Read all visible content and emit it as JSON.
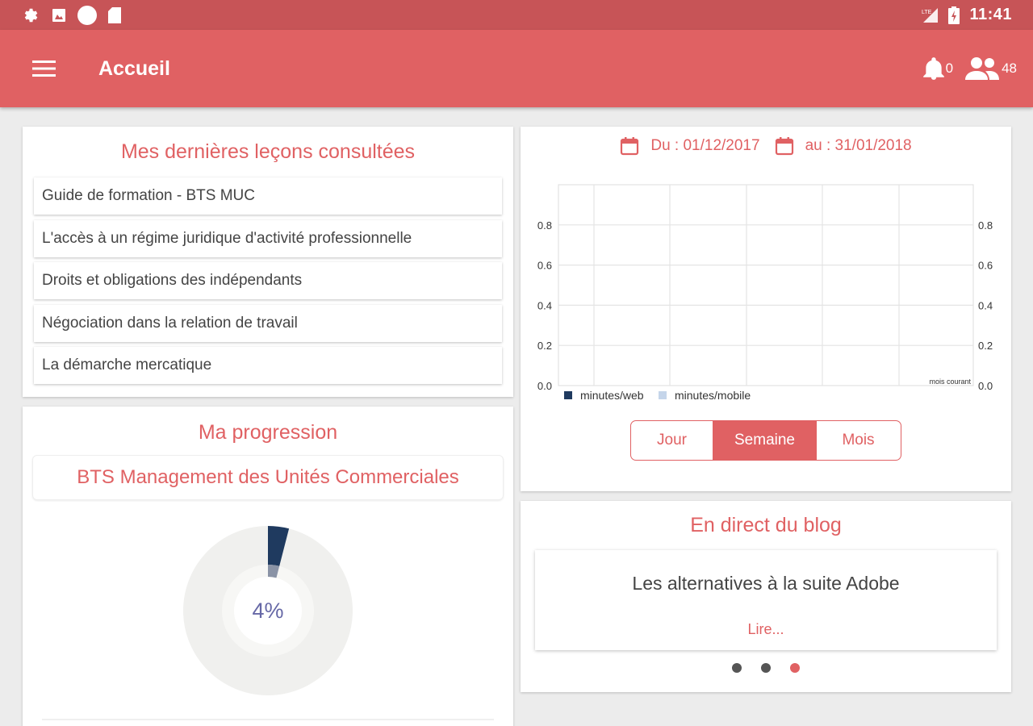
{
  "status_bar": {
    "time": "11:41",
    "icons": [
      "gear-icon",
      "image-icon",
      "circle-icon",
      "sd-card-icon",
      "signal-icon",
      "battery-charging-icon"
    ]
  },
  "app_bar": {
    "title": "Accueil",
    "notifications_count": "0",
    "users_count": "48"
  },
  "lessons": {
    "title": "Mes dernières leçons consultées",
    "items": [
      "Guide de formation - BTS MUC",
      "L'accès à un régime juridique d'activité professionnelle",
      "Droits et obligations des indépendants",
      "Négociation dans la relation de travail",
      "La démarche mercatique"
    ]
  },
  "progress": {
    "title": "Ma progression",
    "course": "BTS Management des Unités Commerciales",
    "percent_label": "4%",
    "percent_value": 0.04
  },
  "stats": {
    "date_from": "Du : 01/12/2017",
    "date_to": "au : 31/01/2018",
    "period_buttons": [
      "Jour",
      "Semaine",
      "Mois"
    ],
    "active_period": 1
  },
  "chart_data": {
    "type": "area",
    "categories": [],
    "series": [
      {
        "name": "minutes/web",
        "values": []
      },
      {
        "name": "minutes/mobile",
        "values": []
      }
    ],
    "ylim": [
      0,
      0.8
    ],
    "yticks": [
      "0.0",
      "0.2",
      "0.4",
      "0.6",
      "0.8"
    ],
    "y2ticks": [
      "0.0",
      "0.2",
      "0.4",
      "0.6",
      "0.8"
    ],
    "annotation": "mois courant",
    "grid": true,
    "legend": "bottom-left",
    "colors": {
      "web": "#1f3a5f",
      "mobile": "#c5d5ea"
    }
  },
  "blog": {
    "title": "En direct du blog",
    "headline": "Les alternatives à la suite Adobe",
    "link": "Lire...",
    "dots": 3,
    "active_dot": 2
  },
  "colors": {
    "primary": "#e06163",
    "status_bar": "#c75457",
    "donut_fill": "#1f3a5f"
  }
}
